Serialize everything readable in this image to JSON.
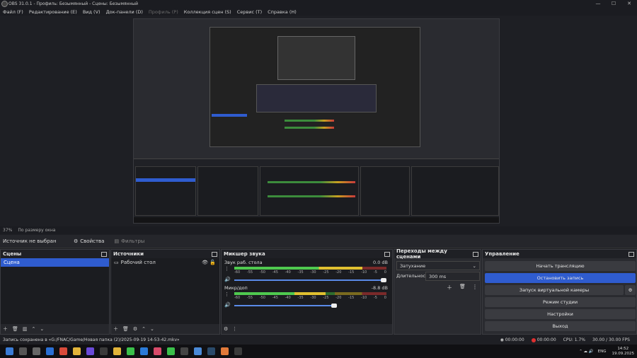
{
  "window": {
    "title": "OBS 31.0.1 - Профиль: Безымянный - Сцены: Безымянный",
    "min": "—",
    "max": "☐",
    "close": "✕"
  },
  "menu": [
    "Файл (F)",
    "Редактирование (E)",
    "Вид (V)",
    "Док-панели (D)",
    "Профиль (P)",
    "Коллекция сцен (S)",
    "Сервис (T)",
    "Справка (H)"
  ],
  "zoom": {
    "percent": "37%",
    "label": "По размеру окна"
  },
  "context": {
    "source": "Источник не выбран",
    "properties": "Свойства",
    "filters": "Фильтры"
  },
  "scenes": {
    "title": "Сцены",
    "items": [
      "Сцена"
    ]
  },
  "sources": {
    "title": "Источники",
    "items": [
      "Рабочий стол"
    ]
  },
  "mixer": {
    "title": "Микшер звука",
    "tracks": [
      {
        "name": "Звук раб. стола",
        "db": "0.0 dB",
        "level": 0.84
      },
      {
        "name": "Микр/доп",
        "db": "-8.8 dB",
        "level": 0.6
      }
    ],
    "ticks": [
      "-60",
      "-55",
      "-50",
      "-45",
      "-40",
      "-35",
      "-30",
      "-25",
      "-20",
      "-15",
      "-10",
      "-5",
      "0"
    ]
  },
  "transitions": {
    "title": "Переходы между сценами",
    "type": "Затухание",
    "duration_label": "Длительность",
    "duration": "300 ms"
  },
  "controls": {
    "title": "Управление",
    "start_stream": "Начать трансляцию",
    "stop_record": "Остановить запись",
    "virtual_cam": "Запуск виртуальной камеры",
    "studio": "Режим студии",
    "settings": "Настройки",
    "exit": "Выход"
  },
  "status": {
    "message": "Запись сохранена в «G:/FNAC/Game/Новая папка (2)/2025-09-19 14-53-42.mkv»",
    "stream_time": "00:00:00",
    "rec_time": "00:00:00",
    "cpu": "CPU: 1.7%",
    "fps": "30.00 / 30.00 FPS"
  },
  "tray": {
    "lang": "ENG",
    "time": "14:52",
    "date": "19.09.2025"
  },
  "colors": {
    "accent": "#2f5ccf",
    "rec": "#e03030"
  }
}
